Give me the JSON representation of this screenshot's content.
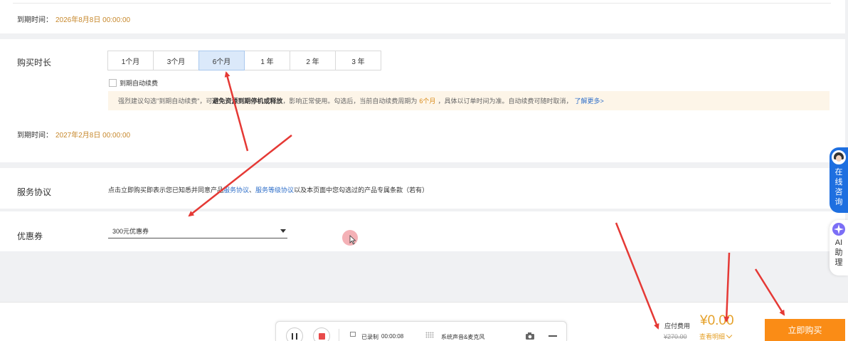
{
  "top": {
    "expiry_label": "到期时间：",
    "expiry_value": "2026年8月8日 00:00:00"
  },
  "duration": {
    "label": "购买时长",
    "options": [
      "1个月",
      "3个月",
      "6个月",
      "1 年",
      "2 年",
      "3 年"
    ],
    "selected": "6个月",
    "auto_renew_label": "到期自动续费",
    "auto_renew_checked": false,
    "notice": {
      "part1": "强烈建议勾选\"到期自动续费\"，可",
      "bold": "避免资源到期停机或释放",
      "part2": "，影响正常使用。勾选后，当前自动续费周期为",
      "period": "6个月",
      "part3": "，具体以订单时间为准。自动续费可随时取消，",
      "link": "了解更多>"
    },
    "expiry_label": "到期时间：",
    "expiry_value": "2027年2月8日 00:00:00"
  },
  "service": {
    "label": "服务协议",
    "text1": "点击立即购买即表示您已知悉并同意产品",
    "link1": "服务协议",
    "sep": "、",
    "link2": "服务等级协议",
    "text2": "以及本页面中您勾选过的产品专属条款（若有）"
  },
  "coupon": {
    "label": "优惠券",
    "selected": "300元优惠券"
  },
  "footer": {
    "fee_label": "应付费用",
    "original_price": "¥270.00",
    "price": "¥0.00",
    "detail_link": "查看明细",
    "buy_button": "立即购买"
  },
  "recorder": {
    "status": "已录制",
    "time": "00:00:08",
    "audio": "系统声音&麦克风"
  },
  "float": {
    "consult": [
      "在",
      "线",
      "咨",
      "询"
    ],
    "ai": [
      "AI",
      "助",
      "理"
    ]
  },
  "colors": {
    "accent_orange": "#fa8c16",
    "price_gold": "#e5a12a",
    "link_blue": "#2f6fc9",
    "tab_active": "#dbe9fa",
    "arrow_red": "#e53935"
  }
}
